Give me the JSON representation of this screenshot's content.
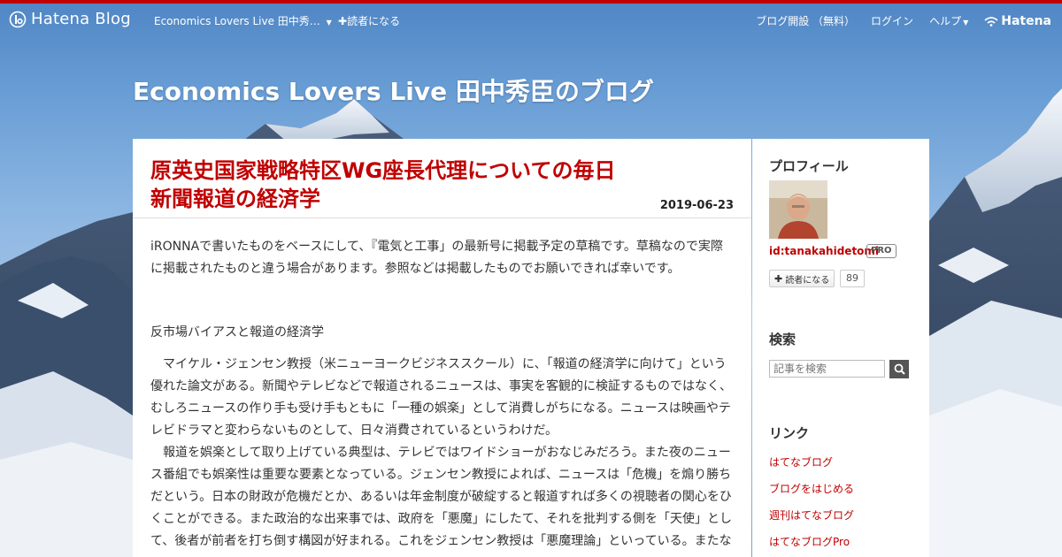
{
  "global_header": {
    "logo_text": "Hatena Blog",
    "blog_menu_label": "Economics Lovers Live 田中秀…",
    "subscribe_label": "読者になる",
    "start_blog_label": "ブログ開設 （無料）",
    "login_label": "ログイン",
    "help_label": "ヘルプ",
    "hatena_label": "Hatena"
  },
  "blog": {
    "title": "Economics Lovers Live 田中秀臣のブログ"
  },
  "entry": {
    "title_line1": "原英史国家戦略特区WG座長代理についての毎日",
    "title_line2": "新聞報道の経済学",
    "date": "2019-06-23",
    "paragraphs": [
      "iRONNAで書いたものをベースにして、『電気と工事」の最新号に掲載予定の草稿です。草稿なので実際に掲載されたものと違う場合があります。参照などは掲載したものでお願いできれば幸いです。",
      "反市場バイアスと報道の経済学",
      "マイケル・ジェンセン教授（米ニューヨークビジネススクール）に、「報道の経済学に向けて」という優れた論文がある。新聞やテレビなどで報道されるニュースは、事実を客観的に検証するものではなく、むしろニュースの作り手も受け手もともに「一種の娯楽」として消費しがちになる。ニュースは映画やテレビドラマと変わらないものとして、日々消費されているというわけだ。",
      "報道を娯楽として取り上げている典型は、テレビではワイドショーがおなじみだろう。また夜のニュース番組でも娯楽性は重要な要素となっている。ジェンセン教授によれば、ニュースは「危機」を煽り勝ちだという。日本の財政が危機だとか、あるいは年金制度が破綻すると報道すれば多くの視聴者の関心をひくことができる。また政治的な出来事では、政府を「悪魔」にしたて、それを批判する側を「天使」として、後者が前者を打ち倒す構図が好まれる。これをジェンセン教授は「悪魔理論」といっている。またな"
    ]
  },
  "sidebar": {
    "profile_heading": "プロフィール",
    "profile_id": "id:tanakahidetomi",
    "pro_badge": "PRO",
    "subscribe_button": "読者になる",
    "subscriber_count": "89",
    "search_heading": "検索",
    "search_placeholder": "記事を検索",
    "links_heading": "リンク",
    "links": [
      "はてなブログ",
      "ブログをはじめる",
      "週刊はてなブログ",
      "はてなブログPro"
    ]
  },
  "colors": {
    "accent": "#c00000",
    "sky": "#6b9fd6",
    "card": "#ffffff"
  }
}
